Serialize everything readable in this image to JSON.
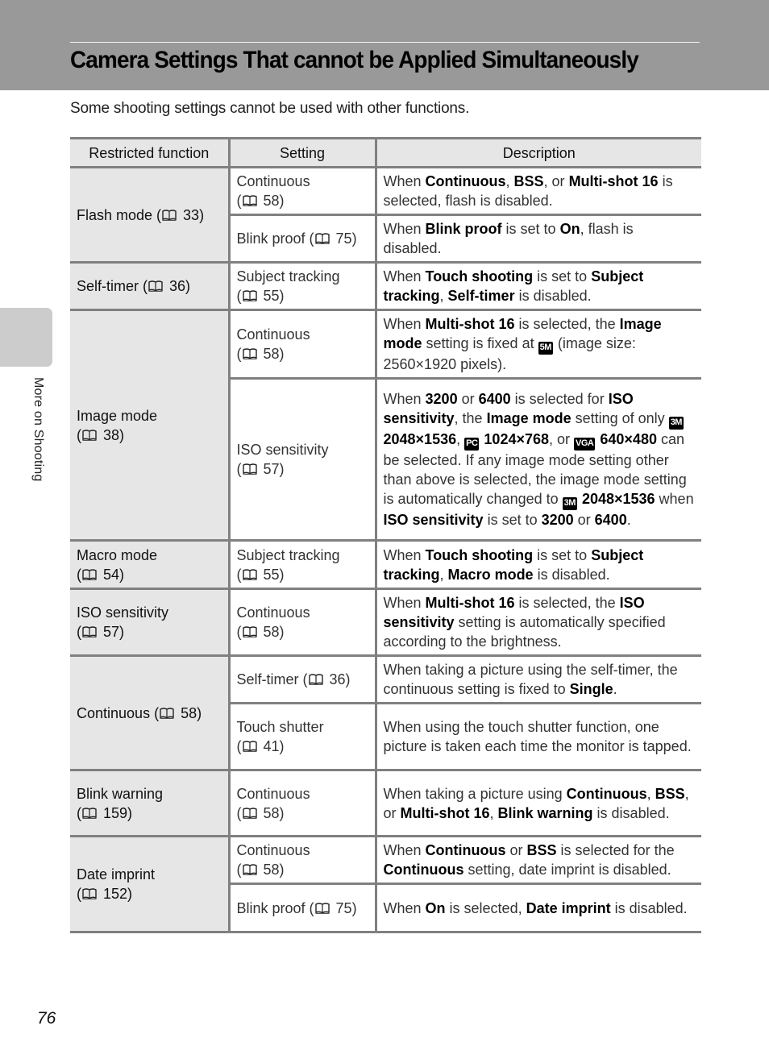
{
  "header": {
    "title": "Camera Settings That cannot be Applied Simultaneously"
  },
  "intro": "Some shooting settings cannot be used with other functions.",
  "side_tab": {
    "label": "More on Shooting"
  },
  "page_number": "76",
  "table": {
    "columns": [
      "Restricted function",
      "Setting",
      "Description"
    ],
    "icons": {
      "book": "book-reference-icon"
    },
    "rows": [
      {
        "function": "Flash mode (",
        "function_page": "33)",
        "function_multiline": false,
        "settings": [
          {
            "name": "Continuous",
            "page": "58)",
            "multiline": true,
            "description": [
              [
                "When ",
                0
              ],
              [
                "Continuous",
                1
              ],
              [
                ", ",
                0
              ],
              [
                "BSS",
                1
              ],
              [
                ", or ",
                0
              ],
              [
                "Multi-shot 16",
                1
              ],
              [
                " is selected, flash is disabled.",
                0
              ]
            ]
          },
          {
            "name": "Blink proof",
            "page": "75)",
            "multiline": false,
            "description": [
              [
                "When ",
                0
              ],
              [
                "Blink proof",
                1
              ],
              [
                " is set to ",
                0
              ],
              [
                "On",
                1
              ],
              [
                ", flash is disabled.",
                0
              ]
            ]
          }
        ]
      },
      {
        "function": "Self-timer (",
        "function_page": "36)",
        "function_multiline": false,
        "settings": [
          {
            "name": "Subject tracking",
            "page": "55)",
            "multiline": true,
            "description": [
              [
                "When ",
                0
              ],
              [
                "Touch shooting",
                1
              ],
              [
                " is set to ",
                0
              ],
              [
                "Subject tracking",
                1
              ],
              [
                ", ",
                0
              ],
              [
                "Self-timer",
                1
              ],
              [
                " is disabled.",
                0
              ]
            ]
          }
        ]
      },
      {
        "function": "Image mode",
        "function_page": "38)",
        "function_multiline": true,
        "settings": [
          {
            "name": "Continuous",
            "page": "58)",
            "multiline": true,
            "description": [
              [
                "When ",
                0
              ],
              [
                "Multi-shot 16",
                1
              ],
              [
                " is selected, the ",
                0
              ],
              [
                "Image mode",
                1
              ],
              [
                " setting is fixed at ",
                0
              ],
              [
                "5M",
                2
              ],
              [
                " (image size: 2560×1920 pixels).",
                0
              ]
            ]
          },
          {
            "name": "ISO sensitivity",
            "page": "57)",
            "multiline": true,
            "description": [
              [
                "When ",
                0
              ],
              [
                "3200",
                1
              ],
              [
                " or ",
                0
              ],
              [
                "6400",
                1
              ],
              [
                " is selected for ",
                0
              ],
              [
                "ISO sensitivity",
                1
              ],
              [
                ", the ",
                0
              ],
              [
                "Image mode",
                1
              ],
              [
                " setting of only ",
                0
              ],
              [
                "3M",
                2
              ],
              [
                " ",
                0
              ],
              [
                "2048×1536",
                1
              ],
              [
                ", ",
                0
              ],
              [
                "PC",
                2
              ],
              [
                " ",
                0
              ],
              [
                "1024×768",
                1
              ],
              [
                ", or ",
                0
              ],
              [
                "VGA",
                2
              ],
              [
                " ",
                0
              ],
              [
                "640×480",
                1
              ],
              [
                " can be selected. If any image mode setting other than above is selected, the image mode setting is automatically changed to ",
                0
              ],
              [
                "3M",
                2
              ],
              [
                " ",
                0
              ],
              [
                "2048×1536",
                1
              ],
              [
                " when ",
                0
              ],
              [
                "ISO sensitivity",
                1
              ],
              [
                " is set to ",
                0
              ],
              [
                "3200",
                1
              ],
              [
                " or ",
                0
              ],
              [
                "6400",
                1
              ],
              [
                ".",
                0
              ]
            ]
          }
        ]
      },
      {
        "function": "Macro mode",
        "function_page": "54)",
        "function_multiline": true,
        "settings": [
          {
            "name": "Subject tracking",
            "page": "55)",
            "multiline": true,
            "description": [
              [
                "When ",
                0
              ],
              [
                "Touch shooting",
                1
              ],
              [
                " is set to ",
                0
              ],
              [
                "Subject tracking",
                1
              ],
              [
                ", ",
                0
              ],
              [
                "Macro mode",
                1
              ],
              [
                " is disabled.",
                0
              ]
            ]
          }
        ]
      },
      {
        "function": "ISO sensitivity",
        "function_page": "57)",
        "function_multiline": true,
        "settings": [
          {
            "name": "Continuous",
            "page": "58)",
            "multiline": true,
            "description": [
              [
                "When ",
                0
              ],
              [
                "Multi-shot 16",
                1
              ],
              [
                " is selected, the ",
                0
              ],
              [
                "ISO sensitivity",
                1
              ],
              [
                " setting is automatically specified according to the brightness.",
                0
              ]
            ]
          }
        ]
      },
      {
        "function": "Continuous (",
        "function_page": "58)",
        "function_multiline": false,
        "settings": [
          {
            "name": "Self-timer",
            "page": "36)",
            "multiline": false,
            "description": [
              [
                "When taking a picture using the self-timer, the continuous setting is fixed to ",
                0
              ],
              [
                "Single",
                1
              ],
              [
                ".",
                0
              ]
            ]
          },
          {
            "name": "Touch shutter",
            "page": "41)",
            "multiline": true,
            "description": [
              [
                "When using the touch shutter function, one picture is taken each time the monitor is tapped.",
                0
              ]
            ]
          }
        ]
      },
      {
        "function": "Blink warning",
        "function_page": "159)",
        "function_multiline": true,
        "settings": [
          {
            "name": "Continuous",
            "page": "58)",
            "multiline": true,
            "description": [
              [
                "When taking a picture using ",
                0
              ],
              [
                "Continuous",
                1
              ],
              [
                ", ",
                0
              ],
              [
                "BSS",
                1
              ],
              [
                ", or ",
                0
              ],
              [
                "Multi-shot 16",
                1
              ],
              [
                ", ",
                0
              ],
              [
                "Blink warning",
                1
              ],
              [
                " is disabled.",
                0
              ]
            ]
          }
        ]
      },
      {
        "function": "Date imprint",
        "function_page": "152)",
        "function_multiline": true,
        "settings": [
          {
            "name": "Continuous",
            "page": "58)",
            "multiline": true,
            "description": [
              [
                "When ",
                0
              ],
              [
                "Continuous",
                1
              ],
              [
                " or ",
                0
              ],
              [
                "BSS",
                1
              ],
              [
                " is selected for the ",
                0
              ],
              [
                "Continuous",
                1
              ],
              [
                " setting, date imprint is disabled.",
                0
              ]
            ]
          },
          {
            "name": "Blink proof",
            "page": "75)",
            "multiline": false,
            "description": [
              [
                "When ",
                0
              ],
              [
                "On",
                1
              ],
              [
                " is selected, ",
                0
              ],
              [
                "Date imprint",
                1
              ],
              [
                " is disabled.",
                0
              ]
            ]
          }
        ]
      }
    ]
  }
}
